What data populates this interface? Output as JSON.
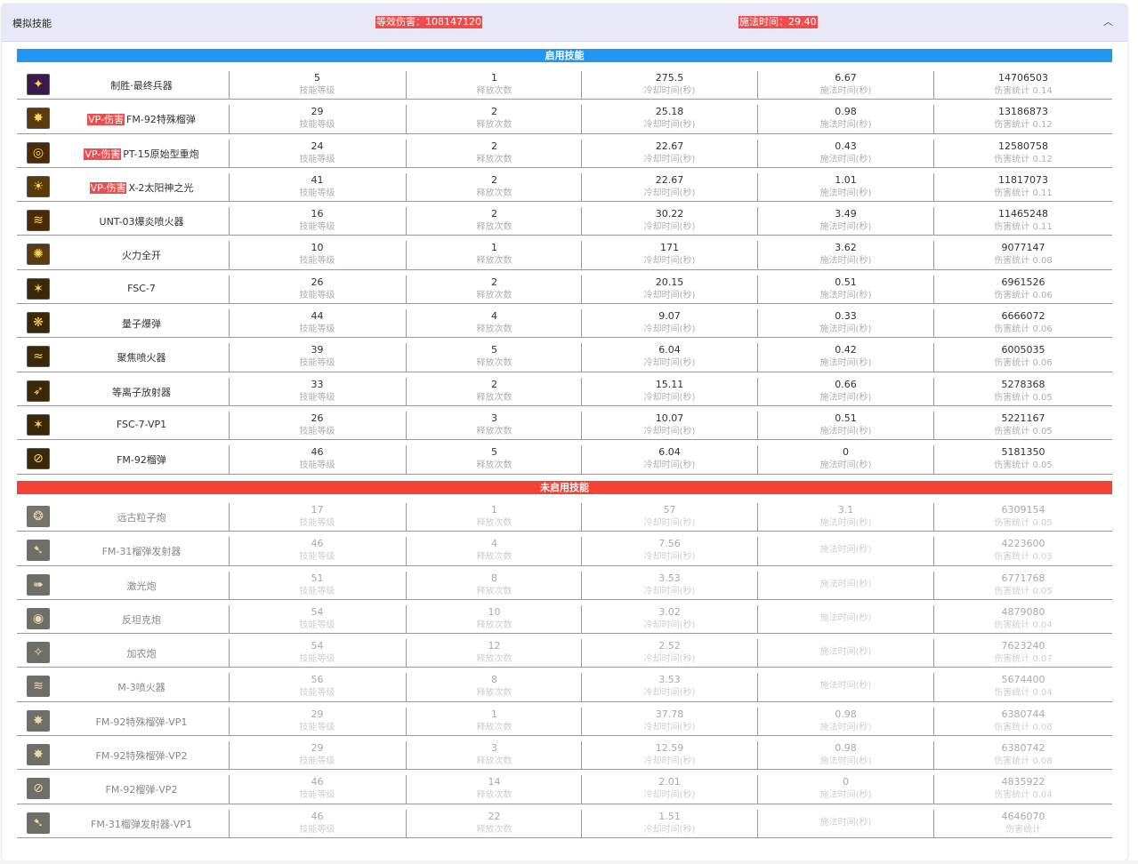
{
  "header": {
    "title": "模拟技能",
    "damage": "等效伤害：108147120",
    "cast_time": "施法时间：29.40",
    "collapse_icon": "chevron-up-icon"
  },
  "labels": {
    "level": "技能等级",
    "casts": "释放次数",
    "cooldown": "冷却时间(秒)",
    "cast": "施法时间(秒)",
    "dmg": "伤害统计"
  },
  "enabled": {
    "title": "启用技能",
    "color": "#2196f3",
    "rows": [
      {
        "icon": "final-weapon-icon",
        "icon_bg": "#3a1a4a",
        "glyph": "✦",
        "vp": "",
        "name": "制胜·最终兵器",
        "level": "5",
        "casts": "1",
        "cooldown": "275.5",
        "cast": "6.67",
        "dmg": "14706503",
        "dmg_label": "伤害统计 0.14"
      },
      {
        "icon": "grenade-icon",
        "icon_bg": "#5a3a10",
        "glyph": "✸",
        "vp": "VP-伤害",
        "name": "FM-92特殊榴弹",
        "level": "29",
        "casts": "2",
        "cooldown": "25.18",
        "cast": "0.98",
        "dmg": "13186873",
        "dmg_label": "伤害统计 0.12"
      },
      {
        "icon": "cannon-icon",
        "icon_bg": "#4a2a08",
        "glyph": "◎",
        "vp": "VP-伤害",
        "name": "PT-15原始型重炮",
        "level": "24",
        "casts": "2",
        "cooldown": "22.67",
        "cast": "0.43",
        "dmg": "12580758",
        "dmg_label": "伤害统计 0.12"
      },
      {
        "icon": "sun-icon",
        "icon_bg": "#5a3a08",
        "glyph": "☀",
        "vp": "VP-伤害",
        "name": "X-2太阳神之光",
        "level": "41",
        "casts": "2",
        "cooldown": "22.67",
        "cast": "1.01",
        "dmg": "11817073",
        "dmg_label": "伤害统计 0.11"
      },
      {
        "icon": "flamethrower-icon",
        "icon_bg": "#4a2a08",
        "glyph": "≋",
        "vp": "",
        "name": "UNT-03爆炎喷火器",
        "level": "16",
        "casts": "2",
        "cooldown": "30.22",
        "cast": "3.49",
        "dmg": "11465248",
        "dmg_label": "伤害统计 0.11"
      },
      {
        "icon": "full-fire-icon",
        "icon_bg": "#5a3a10",
        "glyph": "✺",
        "vp": "",
        "name": "火力全开",
        "level": "10",
        "casts": "1",
        "cooldown": "171",
        "cast": "3.62",
        "dmg": "9077147",
        "dmg_label": "伤害统计 0.08"
      },
      {
        "icon": "fsc-icon",
        "icon_bg": "#3a2808",
        "glyph": "✶",
        "vp": "",
        "name": "FSC-7",
        "level": "26",
        "casts": "2",
        "cooldown": "20.15",
        "cast": "0.51",
        "dmg": "6961526",
        "dmg_label": "伤害统计 0.06"
      },
      {
        "icon": "quantum-bomb-icon",
        "icon_bg": "#3a2808",
        "glyph": "❋",
        "vp": "",
        "name": "量子爆弹",
        "level": "44",
        "casts": "4",
        "cooldown": "9.07",
        "cast": "0.33",
        "dmg": "6666072",
        "dmg_label": "伤害统计 0.06"
      },
      {
        "icon": "focus-flame-icon",
        "icon_bg": "#3a2808",
        "glyph": "≈",
        "vp": "",
        "name": "聚焦喷火器",
        "level": "39",
        "casts": "5",
        "cooldown": "6.04",
        "cast": "0.42",
        "dmg": "6005035",
        "dmg_label": "伤害统计 0.06"
      },
      {
        "icon": "plasma-icon",
        "icon_bg": "#3a2808",
        "glyph": "➶",
        "vp": "",
        "name": "等离子放射器",
        "level": "33",
        "casts": "2",
        "cooldown": "15.11",
        "cast": "0.66",
        "dmg": "5278368",
        "dmg_label": "伤害统计 0.05"
      },
      {
        "icon": "fsc-vp-icon",
        "icon_bg": "#3a2808",
        "glyph": "✶",
        "vp": "",
        "name": "FSC-7-VP1",
        "level": "26",
        "casts": "3",
        "cooldown": "10.07",
        "cast": "0.51",
        "dmg": "5221167",
        "dmg_label": "伤害统计 0.05"
      },
      {
        "icon": "grenade-shell-icon",
        "icon_bg": "#3a2808",
        "glyph": "⊘",
        "vp": "",
        "name": "FM-92榴弹",
        "level": "46",
        "casts": "5",
        "cooldown": "6.04",
        "cast": "0",
        "dmg": "5181350",
        "dmg_label": "伤害统计 0.05"
      }
    ]
  },
  "disabled": {
    "title": "未启用技能",
    "color": "#f44336",
    "rows": [
      {
        "icon": "ancient-particle-icon",
        "icon_bg": "#6a5a4a",
        "glyph": "❂",
        "name": "远古粒子炮",
        "level": "17",
        "casts": "1",
        "cooldown": "57",
        "cast": "3.1",
        "dmg": "6309154",
        "dmg_label": "伤害统计 0.05"
      },
      {
        "icon": "grenade-launcher-icon",
        "icon_bg": "#5a5548",
        "glyph": "➷",
        "name": "FM-31榴弹发射器",
        "level": "46",
        "casts": "4",
        "cooldown": "7.56",
        "cast": "",
        "dmg": "4223600",
        "dmg_label": "伤害统计 0.03"
      },
      {
        "icon": "laser-icon",
        "icon_bg": "#5a5548",
        "glyph": "➠",
        "name": "激光炮",
        "level": "51",
        "casts": "8",
        "cooldown": "3.53",
        "cast": "",
        "dmg": "6771768",
        "dmg_label": "伤害统计 0.05"
      },
      {
        "icon": "anti-tank-icon",
        "icon_bg": "#5a5548",
        "glyph": "◉",
        "name": "反坦克炮",
        "level": "54",
        "casts": "10",
        "cooldown": "3.02",
        "cast": "",
        "dmg": "4879080",
        "dmg_label": "伤害统计 0.04"
      },
      {
        "icon": "gatling-icon",
        "icon_bg": "#5a5548",
        "glyph": "✧",
        "name": "加农炮",
        "level": "54",
        "casts": "12",
        "cooldown": "2.52",
        "cast": "",
        "dmg": "7623240",
        "dmg_label": "伤害统计 0.07"
      },
      {
        "icon": "m3-flame-icon",
        "icon_bg": "#5a5548",
        "glyph": "≋",
        "name": "M-3喷火器",
        "level": "56",
        "casts": "8",
        "cooldown": "3.53",
        "cast": "",
        "dmg": "5674400",
        "dmg_label": "伤害统计 0.04"
      },
      {
        "icon": "grenade-vp1-icon",
        "icon_bg": "#5a5548",
        "glyph": "✸",
        "name": "FM-92特殊榴弹-VP1",
        "level": "29",
        "casts": "1",
        "cooldown": "37.78",
        "cast": "0.98",
        "dmg": "6380744",
        "dmg_label": "伤害统计 0.08"
      },
      {
        "icon": "grenade-vp2-icon",
        "icon_bg": "#5a5548",
        "glyph": "✸",
        "name": "FM-92特殊榴弹-VP2",
        "level": "29",
        "casts": "3",
        "cooldown": "12.59",
        "cast": "0.98",
        "dmg": "6380742",
        "dmg_label": "伤害统计 0.08"
      },
      {
        "icon": "grenade-shell-vp2-icon",
        "icon_bg": "#5a5548",
        "glyph": "⊘",
        "name": "FM-92榴弹-VP2",
        "level": "46",
        "casts": "14",
        "cooldown": "2.01",
        "cast": "0",
        "dmg": "4835922",
        "dmg_label": "伤害统计 0.04"
      },
      {
        "icon": "launcher-vp1-icon",
        "icon_bg": "#5a5548",
        "glyph": "➷",
        "name": "FM-31榴弹发射器-VP1",
        "level": "46",
        "casts": "22",
        "cooldown": "1.51",
        "cast": "",
        "dmg": "4646070",
        "dmg_label": "伤害统计"
      }
    ]
  }
}
